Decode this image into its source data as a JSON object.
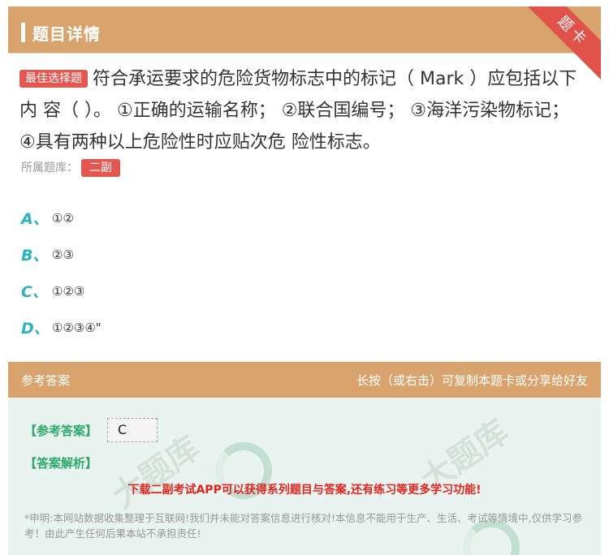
{
  "header": {
    "title": "题目详情",
    "ribbon": "题卡"
  },
  "question": {
    "badge": "最佳选择题",
    "text": "符合承运要求的危险货物标志中的标记（ Mark ）应包括以下内 容（ ）。 ①正确的运输名称； ②联合国编号； ③海洋污染物标记； ④具有两种以上危险性时应贴次危 险性标志。",
    "bank_label": "所属题库：",
    "bank_tag": "二副"
  },
  "options": [
    {
      "letter": "A、",
      "text": "①②"
    },
    {
      "letter": "B、",
      "text": "②③"
    },
    {
      "letter": "C、",
      "text": "①②③"
    },
    {
      "letter": "D、",
      "text": "①②③④\""
    }
  ],
  "answer_bar": {
    "left": "参考答案",
    "right": "长按（或右击）可复制本题卡或分享给好友"
  },
  "answer": {
    "ref_label": "【参考答案】",
    "ref_value": "C",
    "analysis_label": "【答案解析】",
    "promo": "下载二副考试APP可以获得系列题目与答案,还有练习等更多学习功能!",
    "disclaimer": "*申明:本网站数据收集整理于互联网!我们并未能对答案信息进行核对!本信息不能用于生产、生活、考试等情境中,仅供学习参考！由此产生任何后果本站不承担责任!"
  },
  "colors": {
    "header": "#d8a36c",
    "accent_red": "#e2574f",
    "option_letter": "#2bb3c0",
    "answer_green": "#2aa96a",
    "promo_red": "#e0241e"
  }
}
